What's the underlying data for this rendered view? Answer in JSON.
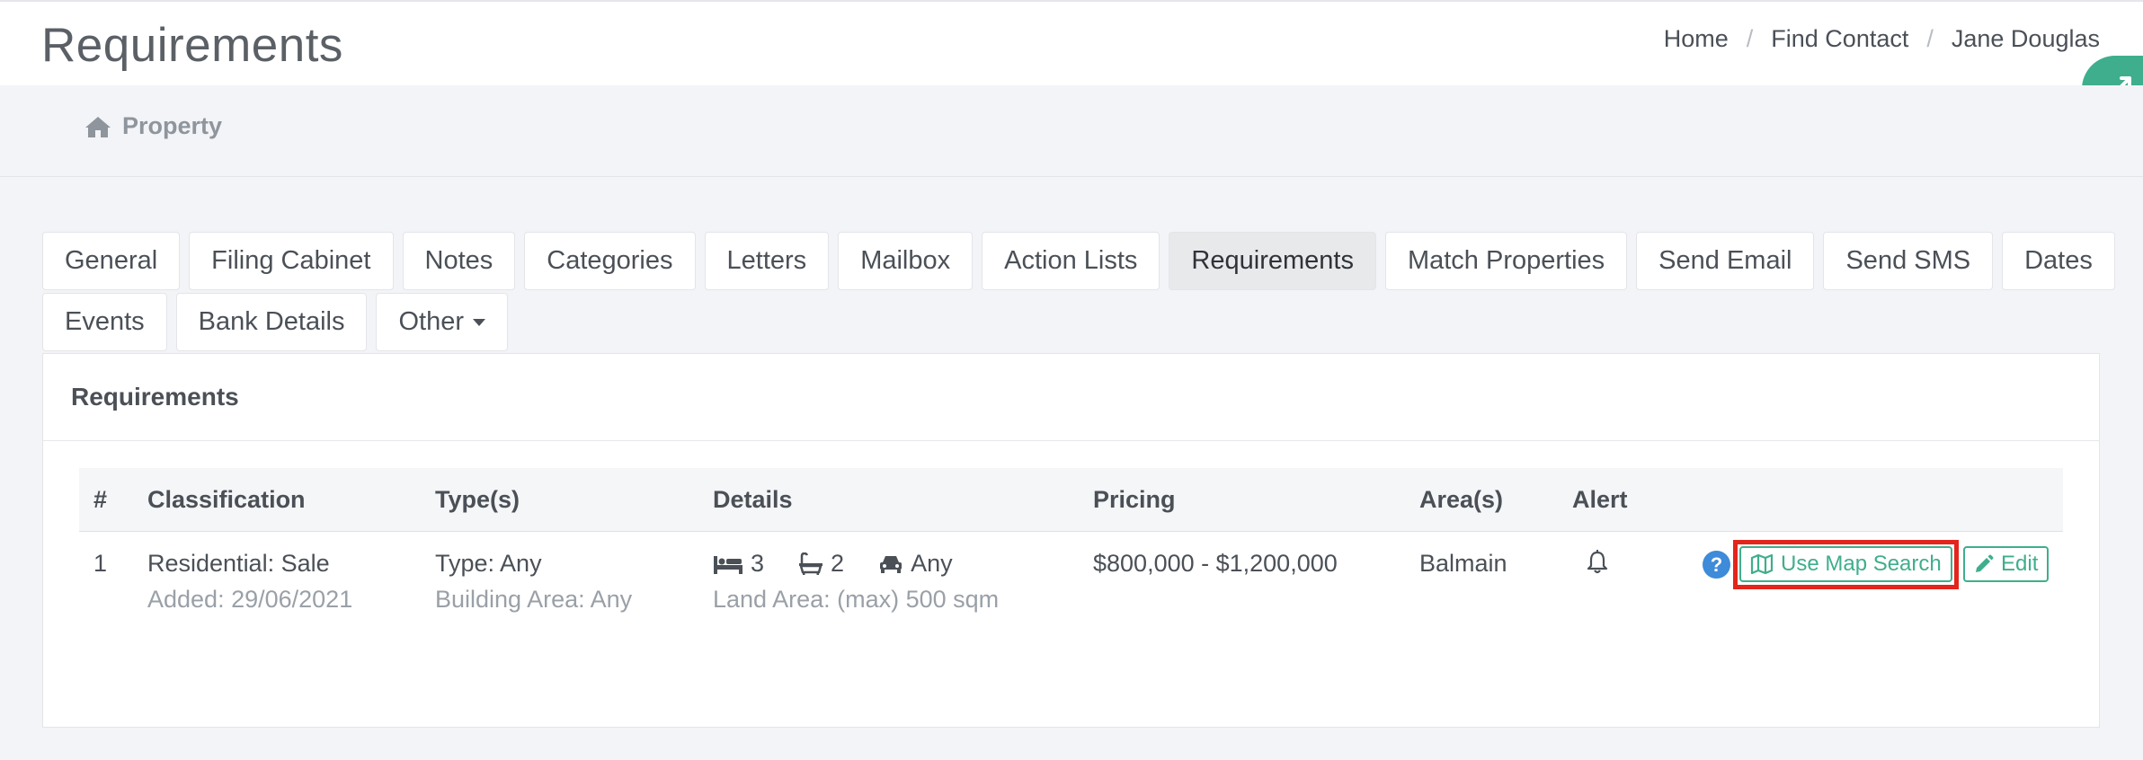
{
  "header": {
    "title": "Requirements",
    "breadcrumb": [
      "Home",
      "Find Contact",
      "Jane Douglas"
    ]
  },
  "subheader": {
    "section": "Property",
    "icon": "home-icon"
  },
  "tabs": {
    "row1": [
      "General",
      "Filing Cabinet",
      "Notes",
      "Categories",
      "Letters",
      "Mailbox",
      "Action Lists",
      "Requirements",
      "Match Properties",
      "Send Email",
      "Send SMS",
      "Dates"
    ],
    "row2": [
      "Events",
      "Bank Details",
      "Other"
    ],
    "active": "Requirements"
  },
  "panel": {
    "title": "Requirements",
    "columns": {
      "num": "#",
      "classification": "Classification",
      "types": "Type(s)",
      "details": "Details",
      "pricing": "Pricing",
      "areas": "Area(s)",
      "alert": "Alert"
    },
    "rows": [
      {
        "num": "1",
        "classification": "Residential: Sale",
        "added": "Added: 29/06/2021",
        "type": "Type: Any",
        "building_area": "Building Area: Any",
        "beds": "3",
        "baths": "2",
        "cars": "Any",
        "land_area": "Land Area: (max) 500 sqm",
        "pricing": "$800,000 - $1,200,000",
        "area": "Balmain"
      }
    ],
    "actions": {
      "help": "?",
      "map_search": "Use Map Search",
      "edit": "Edit"
    }
  },
  "colors": {
    "accent": "#3fae8c",
    "highlight": "#e3251c",
    "help": "#3d8bd9"
  }
}
